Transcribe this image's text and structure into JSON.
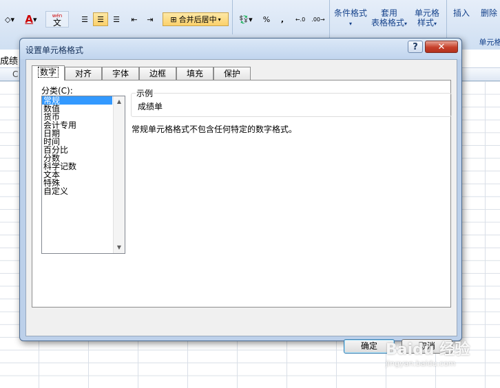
{
  "ribbon": {
    "merge_center_label": "合并后居中",
    "percent_label": "%",
    "comma_label": ",",
    "inc_decimal_label": "←.0",
    "dec_decimal_label": ".00→",
    "wen_label": "wén",
    "wen_char": "文",
    "cond_format_label": "条件格式",
    "table_format_label1": "套用",
    "table_format_label2": "表格格式",
    "cell_style_label1": "单元格",
    "cell_style_label2": "样式",
    "insert_label": "插入",
    "delete_label": "删除",
    "cells_group_label": "单元格",
    "font_color_glyph": "A"
  },
  "formula_bar": {
    "name_text": "成绩"
  },
  "column_header": {
    "c_label": "C"
  },
  "dialog": {
    "title": "设置单元格格式",
    "help_label": "?",
    "close_label": "✕",
    "tabs": [
      "数字",
      "对齐",
      "字体",
      "边框",
      "填充",
      "保护"
    ],
    "category_label": "分类(C):",
    "categories": [
      "常规",
      "数值",
      "货币",
      "会计专用",
      "日期",
      "时间",
      "百分比",
      "分数",
      "科学记数",
      "文本",
      "特殊",
      "自定义"
    ],
    "selected_category": "常规",
    "sample_legend": "示例",
    "sample_value": "成绩单",
    "description": "常规单元格格式不包含任何特定的数字格式。",
    "ok_label": "确定",
    "cancel_label": "取消"
  },
  "watermark": {
    "line1": "Baidu 经验",
    "line2": "jingyan.baidu.com"
  }
}
